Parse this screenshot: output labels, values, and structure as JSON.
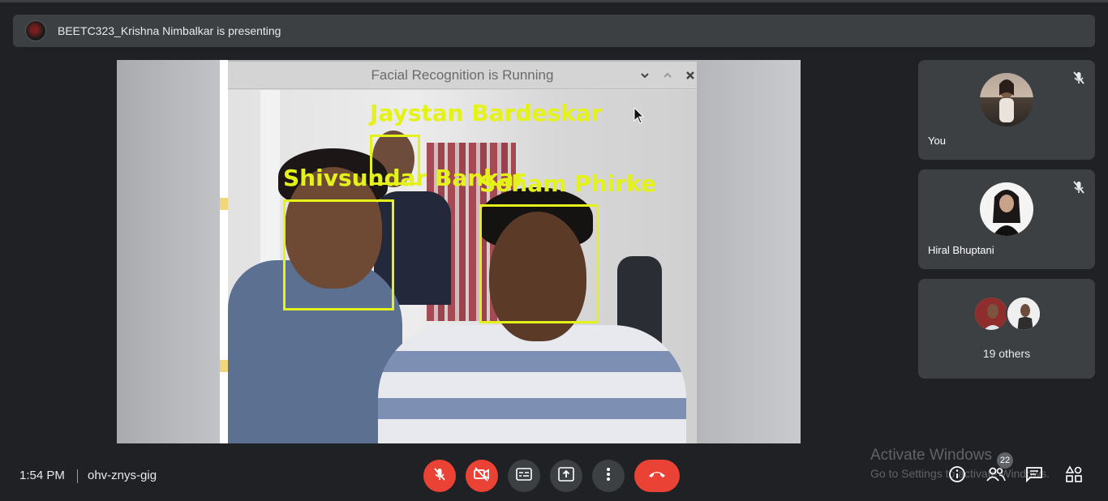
{
  "presentation": {
    "banner_text": "BEETC323_Krishna Nimbalkar is presenting",
    "window_title": "Facial Recognition is Running",
    "face_labels": [
      "Jaystan Bardeskar",
      "Shivsundar Bankar",
      "Soham Phirke"
    ]
  },
  "participants": [
    {
      "name": "You",
      "muted": true,
      "avatar_icon": "person-photo"
    },
    {
      "name": "Hiral Bhuptani",
      "muted": true,
      "avatar_icon": "person-photo"
    }
  ],
  "others": {
    "label": "19 others"
  },
  "meeting": {
    "time": "1:54 PM",
    "code": "ohv-znys-gig"
  },
  "controls": [
    "mic-off-icon",
    "camera-off-icon",
    "captions-icon",
    "present-icon",
    "more-icon",
    "leave-call-icon"
  ],
  "right_controls": {
    "info_icon": "info-icon",
    "people_count": "22",
    "people_icon": "people-icon",
    "chat_icon": "chat-icon",
    "activities_icon": "activities-icon"
  },
  "watermark": {
    "title": "Activate Windows",
    "subtitle": "Go to Settings to activate Windows."
  },
  "colors": {
    "background": "#202124",
    "panel": "#3c4043",
    "danger": "#ea4335",
    "face_box": "#e4f21a"
  }
}
